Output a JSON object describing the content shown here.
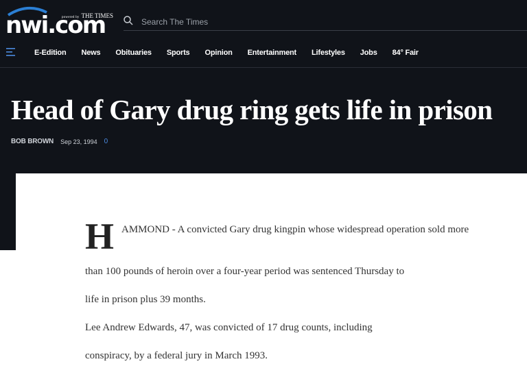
{
  "brand": {
    "logo_text": "nwi.com",
    "powered_small": "powered by",
    "powered_name": "THE TIMES"
  },
  "search": {
    "placeholder": "Search The Times"
  },
  "nav": {
    "items": [
      "E-Edition",
      "News",
      "Obituaries",
      "Sports",
      "Opinion",
      "Entertainment",
      "Lifestyles",
      "Jobs",
      "84° Fair"
    ]
  },
  "article": {
    "headline": "Head of Gary drug ring gets life in prison",
    "author": "BOB BROWN",
    "date": "Sep 23, 1994",
    "comment_count": "0",
    "dropcap": "H",
    "first_paragraph": "AMMOND - A convicted Gary drug kingpin whose widespread operation sold more",
    "paragraphs": [
      "than 100 pounds of heroin over a four-year period was sentenced Thursday to",
      "life in prison plus 39 months.",
      "Lee Andrew Edwards, 47, was convicted of 17 drug counts, including",
      "conspiracy, by a federal jury in March 1993."
    ]
  },
  "colors": {
    "header_bg": "#101319",
    "accent_blue": "#4c8be0",
    "logo_accent": "#2b7fd4"
  }
}
